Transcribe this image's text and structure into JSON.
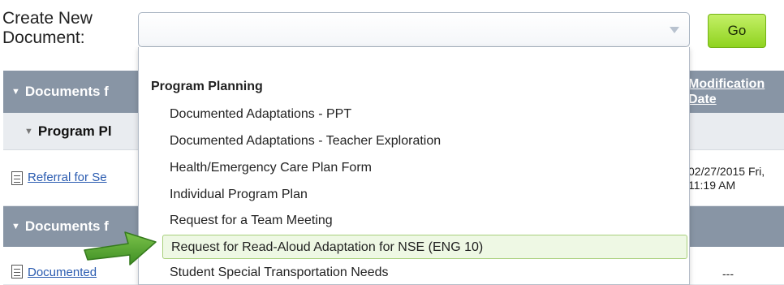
{
  "header": {
    "create_label": "Create New Document:",
    "select_value": "",
    "go_label": "Go"
  },
  "table": {
    "section1_header": "Documents f",
    "section1_sub": "Program Pl",
    "section1_link": "Referral for Se",
    "section1_date": "02/27/2015 Fri, 11:19 AM",
    "section2_header": "Documents f",
    "section2_link": "Documented",
    "section2_date": "---",
    "modification_header": "Modification Date"
  },
  "dropdown": {
    "group_label": "Program Planning",
    "items": [
      "Documented Adaptations - PPT",
      "Documented Adaptations - Teacher Exploration",
      "Health/Emergency Care Plan Form",
      "Individual Program Plan",
      "Request for a Team Meeting",
      "Request for Read-Aloud Adaptation for NSE (ENG 10)",
      "Student Special Transportation Needs"
    ],
    "highlighted_index": 5
  },
  "colors": {
    "go_button": "#8fd31f",
    "header_band": "#8895a5",
    "highlight": "#eef8e4",
    "arrow": "#5aa332"
  }
}
